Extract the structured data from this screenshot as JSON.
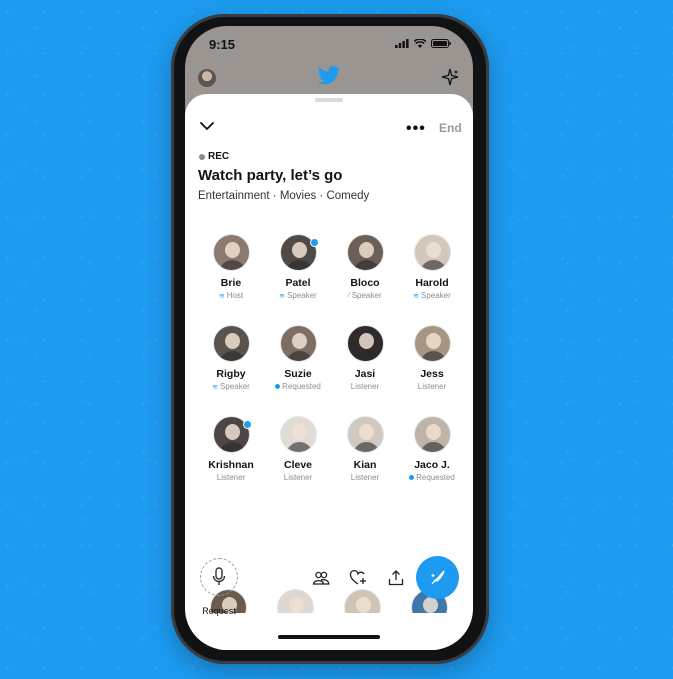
{
  "status": {
    "time": "9:15"
  },
  "space": {
    "recording_label": "REC",
    "title": "Watch party, let’s go",
    "topics": "Entertainment · Movies · Comedy",
    "end_label": "End",
    "more_label": "•••"
  },
  "participants": [
    {
      "name": "Brie",
      "role": "Host",
      "role_icon": "sound-wave-icon",
      "speaking": false
    },
    {
      "name": "Patel",
      "role": "Speaker",
      "role_icon": "sound-wave-icon",
      "speaking": true
    },
    {
      "name": "Bloco",
      "role": "Speaker",
      "role_icon": "mic-off-icon",
      "speaking": false
    },
    {
      "name": "Harold",
      "role": "Speaker",
      "role_icon": "sound-wave-icon",
      "speaking": false
    },
    {
      "name": "Rigby",
      "role": "Speaker",
      "role_icon": "sound-wave-icon",
      "speaking": false
    },
    {
      "name": "Suzie",
      "role": "Requested",
      "role_icon": "request-dot-icon",
      "speaking": false
    },
    {
      "name": "Jasi",
      "role": "Listener",
      "role_icon": "",
      "speaking": false
    },
    {
      "name": "Jess",
      "role": "Listener",
      "role_icon": "",
      "speaking": false
    },
    {
      "name": "Krishnan",
      "role": "Listener",
      "role_icon": "",
      "speaking": true
    },
    {
      "name": "Cleve",
      "role": "Listener",
      "role_icon": "",
      "speaking": false
    },
    {
      "name": "Kian",
      "role": "Listener",
      "role_icon": "",
      "speaking": false
    },
    {
      "name": "Jaco J.",
      "role": "Requested",
      "role_icon": "request-dot-icon",
      "speaking": false
    }
  ],
  "bottom_bar": {
    "request_label": "Request",
    "icons": [
      "people-icon",
      "heart-plus-icon",
      "share-icon",
      "compose-tweet-icon"
    ]
  },
  "colors": {
    "accent": "#1d9bf0",
    "background": "#1d9bf0"
  }
}
